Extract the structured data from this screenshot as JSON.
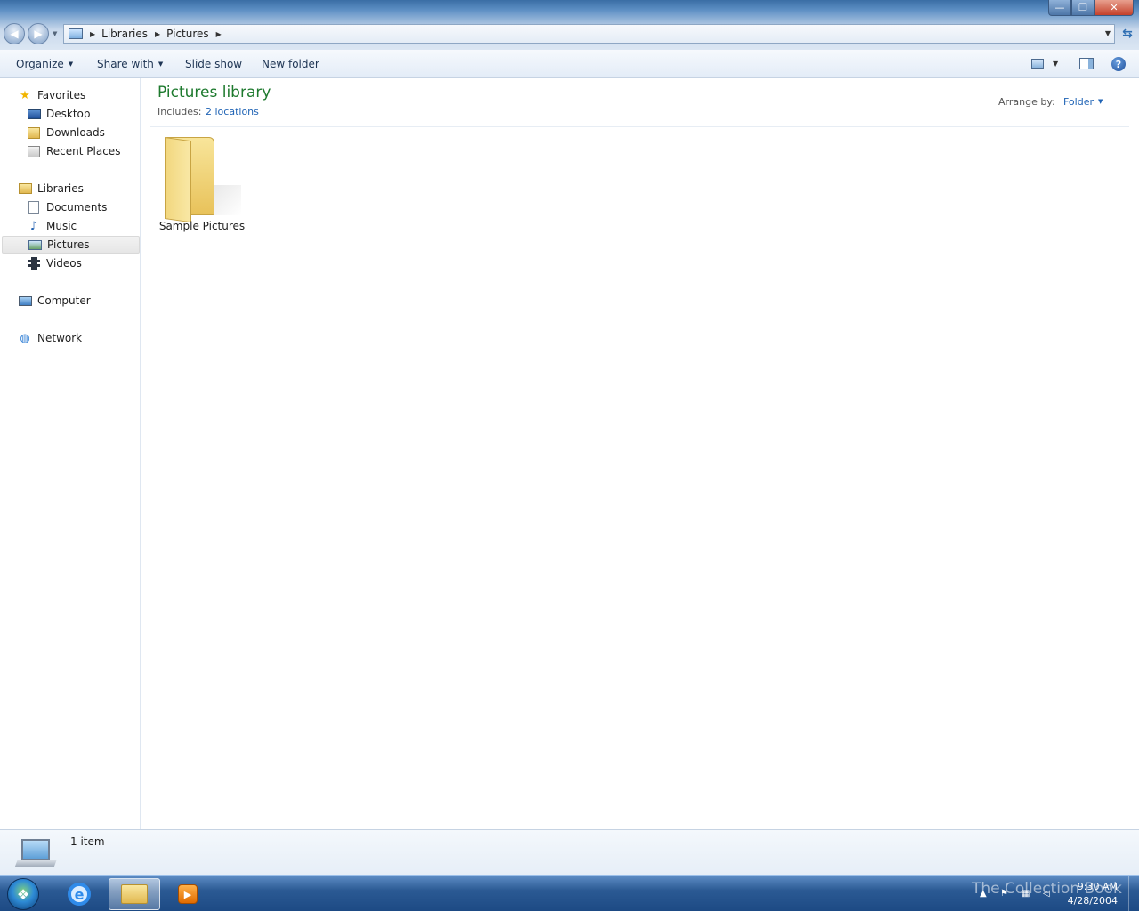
{
  "window": {
    "breadcrumb": [
      "Libraries",
      "Pictures"
    ]
  },
  "toolbar": {
    "organize_label": "Organize",
    "share_label": "Share with",
    "slideshow_label": "Slide show",
    "new_folder_label": "New folder"
  },
  "nav": {
    "favorites": {
      "label": "Favorites",
      "items": [
        {
          "label": "Desktop"
        },
        {
          "label": "Downloads"
        },
        {
          "label": "Recent Places"
        }
      ]
    },
    "libraries": {
      "label": "Libraries",
      "items": [
        {
          "label": "Documents"
        },
        {
          "label": "Music"
        },
        {
          "label": "Pictures",
          "selected": true
        },
        {
          "label": "Videos"
        }
      ]
    },
    "computer_label": "Computer",
    "network_label": "Network"
  },
  "content": {
    "title": "Pictures library",
    "includes_label": "Includes:",
    "includes_link": "2 locations",
    "arrange_label": "Arrange by:",
    "arrange_value": "Folder",
    "items": [
      {
        "name": "Sample Pictures",
        "icon": "folder-icon"
      }
    ]
  },
  "details": {
    "count": "1 item"
  },
  "taskbar": {
    "watermark": "The Collection Book",
    "time": "9:30 AM",
    "date": "4/28/2004"
  },
  "colors": {
    "library_title": "#1e7a2e",
    "link": "#1f63b5",
    "taskbar": "#2b5a94"
  }
}
